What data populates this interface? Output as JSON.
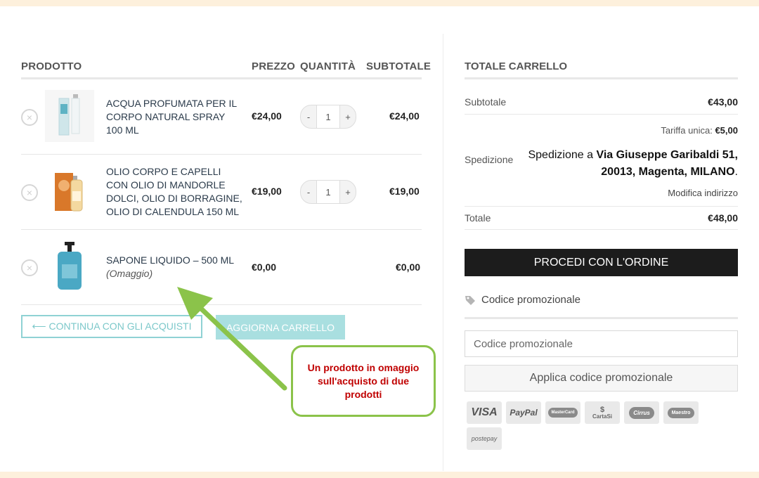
{
  "table": {
    "headers": {
      "product": "PRODOTTO",
      "price": "PREZZO",
      "quantity": "QUANTITÀ",
      "subtotal": "SUBTOTALE"
    },
    "items": [
      {
        "name": "ACQUA PROFUMATA PER IL CORPO NATURAL SPRAY 100 ml",
        "note": "",
        "price": "€24,00",
        "qty": "1",
        "subtotal": "€24,00"
      },
      {
        "name": "OLIO CORPO E CAPELLI CON OLIO DI MANDORLE DOLCI, OLIO DI BORRAGINE, OLIO DI CALENDULA 150 ml",
        "note": "",
        "price": "€19,00",
        "qty": "1",
        "subtotal": "€19,00"
      },
      {
        "name": "SAPONE LIQUIDO – 500 ml",
        "note": "(Omaggio)",
        "price": "€0,00",
        "qty": "",
        "subtotal": "€0,00"
      }
    ],
    "qty_minus": "-",
    "qty_plus": "+",
    "remove_symbol": "×"
  },
  "actions": {
    "continue_label": "⟵ CONTINUA CON GLI ACQUISTI",
    "update_label": "AGGIORNA CARRELLO"
  },
  "annotation": {
    "text": "Un prodotto in omaggio sull'acquisto di due prodotti"
  },
  "cart_totals": {
    "title": "TOTALE CARRELLO",
    "subtotal_label": "Subtotale",
    "subtotal_value": "€43,00",
    "shipping_label": "Spedizione",
    "shipping_rate_label": "Tariffa unica:",
    "shipping_rate_value": "€5,00",
    "shipping_prefix": "Spedizione a ",
    "shipping_street": "Via Giuseppe Garibaldi 51,",
    "shipping_city": "20013, Magenta, MILANO",
    "shipping_suffix": ".",
    "change_address": "Modifica indirizzo",
    "total_label": "Totale",
    "total_value": "€48,00",
    "order_button": "PROCEDI CON L'ORDINE",
    "promo_toggle": "Codice promozionale",
    "promo_placeholder": "Codice promozionale",
    "apply_button": "Applica codice promozionale"
  },
  "payment_methods": [
    "VISA",
    "PayPal",
    "MasterCard",
    "CartaSi",
    "Cirrus",
    "Maestro",
    "postepay"
  ],
  "colors": {
    "accent": "#8fd2d4",
    "order_button": "#1c1c1c",
    "annotation_border": "#8bc34a",
    "annotation_text": "#c00000",
    "band": "#fdf0dc"
  }
}
